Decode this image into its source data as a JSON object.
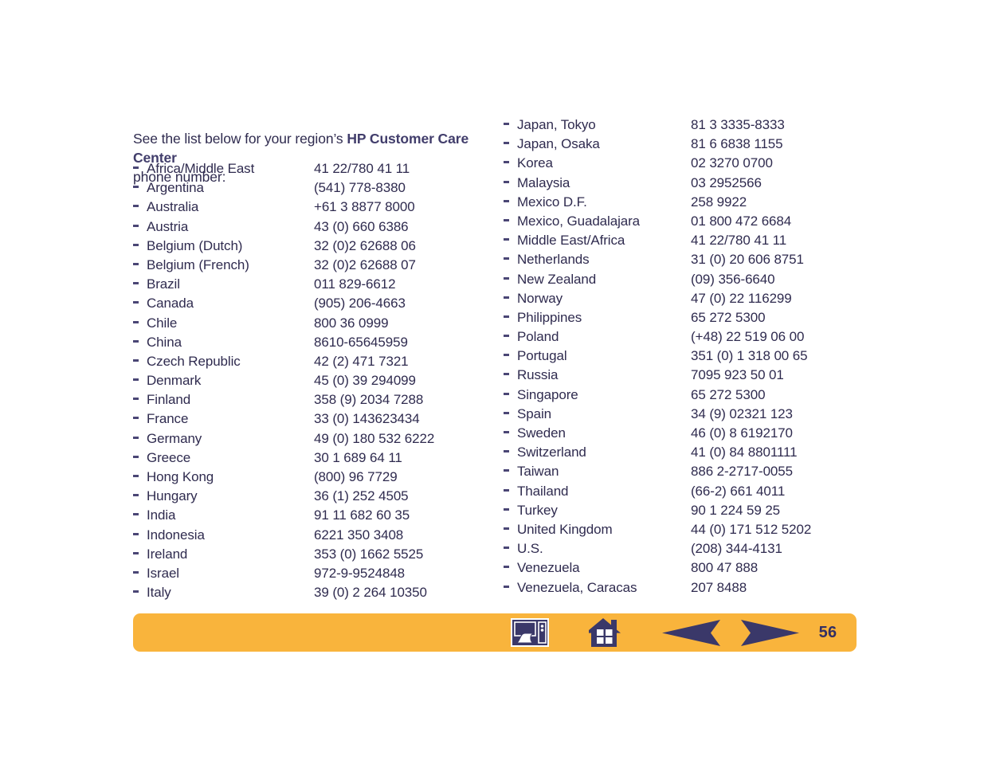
{
  "intro": {
    "lead": "See the list below for your region’s ",
    "emphasis": "HP Customer Care Center",
    "tail": "phone number:"
  },
  "columns": {
    "left": [
      {
        "country": "Africa/Middle East",
        "phone": "41 22/780 41 11"
      },
      {
        "country": "Argentina",
        "phone": "(541) 778-8380"
      },
      {
        "country": "Australia",
        "phone": "+61 3 8877 8000"
      },
      {
        "country": "Austria",
        "phone": "43 (0) 660 6386"
      },
      {
        "country": "Belgium (Dutch)",
        "phone": "32 (0)2 62688 06"
      },
      {
        "country": "Belgium (French)",
        "phone": "32 (0)2 62688 07"
      },
      {
        "country": "Brazil",
        "phone": "011 829-6612"
      },
      {
        "country": "Canada",
        "phone": "(905) 206-4663"
      },
      {
        "country": "Chile",
        "phone": "800 36 0999"
      },
      {
        "country": "China",
        "phone": "8610-65645959"
      },
      {
        "country": "Czech Republic",
        "phone": "42 (2) 471 7321"
      },
      {
        "country": "Denmark",
        "phone": "45 (0) 39 294099"
      },
      {
        "country": "Finland",
        "phone": "358 (9) 2034 7288"
      },
      {
        "country": "France",
        "phone": "33 (0) 143623434"
      },
      {
        "country": "Germany",
        "phone": "49 (0) 180 532 6222"
      },
      {
        "country": "Greece",
        "phone": "30 1 689 64 11"
      },
      {
        "country": "Hong Kong",
        "phone": "(800) 96 7729"
      },
      {
        "country": "Hungary",
        "phone": "36 (1) 252 4505"
      },
      {
        "country": "India",
        "phone": "91 11 682 60 35"
      },
      {
        "country": "Indonesia",
        "phone": "6221 350 3408"
      },
      {
        "country": "Ireland",
        "phone": "353 (0) 1662 5525"
      },
      {
        "country": "Israel",
        "phone": "972-9-9524848"
      },
      {
        "country": "Italy",
        "phone": "39 (0) 2 264 10350"
      }
    ],
    "right": [
      {
        "country": "Japan, Tokyo",
        "phone": "81 3 3335-8333"
      },
      {
        "country": "Japan, Osaka",
        "phone": "81 6 6838 1155"
      },
      {
        "country": "Korea",
        "phone": "02 3270 0700"
      },
      {
        "country": "Malaysia",
        "phone": "03 2952566"
      },
      {
        "country": "Mexico D.F.",
        "phone": "258 9922"
      },
      {
        "country": "Mexico, Guadalajara",
        "phone": "01 800 472 6684"
      },
      {
        "country": "Middle East/Africa",
        "phone": "41 22/780 41 11"
      },
      {
        "country": "Netherlands",
        "phone": "31 (0) 20 606 8751"
      },
      {
        "country": "New Zealand",
        "phone": "(09) 356-6640"
      },
      {
        "country": "Norway",
        "phone": "47 (0) 22 116299"
      },
      {
        "country": "Philippines",
        "phone": "65 272 5300"
      },
      {
        "country": "Poland",
        "phone": "(+48) 22 519 06 00"
      },
      {
        "country": "Portugal",
        "phone": "351 (0) 1 318 00 65"
      },
      {
        "country": "Russia",
        "phone": "7095 923 50 01"
      },
      {
        "country": "Singapore",
        "phone": "65 272 5300"
      },
      {
        "country": "Spain",
        "phone": "34 (9) 02321 123"
      },
      {
        "country": "Sweden",
        "phone": "46 (0) 8 6192170"
      },
      {
        "country": "Switzerland",
        "phone": "41 (0) 84 8801111"
      },
      {
        "country": "Taiwan",
        "phone": "886 2-2717-0055"
      },
      {
        "country": "Thailand",
        "phone": "(66-2) 661 4011"
      },
      {
        "country": "Turkey",
        "phone": "90 1 224 59 25"
      },
      {
        "country": "United Kingdom",
        "phone": "44 (0) 171 512 5202"
      },
      {
        "country": "U.S.",
        "phone": "(208) 344-4131"
      },
      {
        "country": "Venezuela",
        "phone": "800 47 888"
      },
      {
        "country": "Venezuela, Caracas",
        "phone": "207 8488"
      }
    ]
  },
  "navbar": {
    "print_icon": "printer-icon",
    "home_icon": "home-icon",
    "prev_icon": "previous-arrow-icon",
    "next_icon": "next-arrow-icon",
    "page_number": "56"
  },
  "colors": {
    "bar": "#f9b43c",
    "ink": "#2f2b4f",
    "icon": "#3a3869",
    "accent": "#413d6b"
  }
}
